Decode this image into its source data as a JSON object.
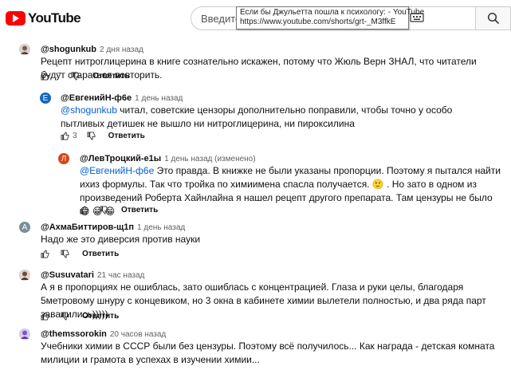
{
  "header": {
    "logo_text": "YouTube",
    "search_value": "Введите",
    "tooltip_title": "Если бы Джульетта пошла к психологу: - YouTube",
    "tooltip_url": "https://www.youtube.com/shorts/grt-_M3ffkE"
  },
  "colors": {
    "mention": "#065fd4",
    "brand_red": "#ff0000"
  },
  "comments": [
    {
      "author": "@shogunkub",
      "time": "2 дня назад",
      "text": "Рецепт нитроглицерина в книге сознательно искажен, потому что Жюль Верн ЗНАЛ, что читатели будут стараться повторить.",
      "likes": "17",
      "reply": "Ответить",
      "avatar_color": "#c9c9c9"
    },
    {
      "author": "@ЕвгенийН-ф6е",
      "time": "1 день назад",
      "avatar_letter": "Е",
      "avatar_color": "#1565c0",
      "mention": "@shogunkub",
      "text": " читал, советские цензоры дополнительно поправили, чтобы точно у особо пытливых детишек не вышло ни нитроглицерина, ни пироксилина",
      "likes": "3",
      "reply": "Ответить"
    },
    {
      "author": "@ЛевТроцкий-е1ы",
      "time": "1 день назад (изменено)",
      "avatar_letter": "Л",
      "avatar_color": "#d84315",
      "mention": "@ЕвгенийН-ф6е",
      "text": " Это правда. В книжке не были указаны пропорции. Поэтому я пытался найти ихиз формулы. Так что тройка по химиимена спасла получается. 🙂 . Но зато в одном из произведений Роберта Хайнлайна я нашел рецепт другого препарата. Там цензуры не было 😁 😁 😁",
      "reply": "Ответить"
    },
    {
      "author": "@АхмаБиттиров-щ1п",
      "time": "1 день назад",
      "avatar_letter": "А",
      "avatar_color": "#78909c",
      "text": "Надо же это диверсия против науки",
      "reply": "Ответить"
    },
    {
      "author": "@Susuvatari",
      "time": "21 час назад",
      "avatar_color": "#8d6e63",
      "text": "А я в пропорциях не ошиблась, зато ошиблась с концентрацией. Глаза и руки целы, благодаря 5метровому шнуру с концевиком, но 3 окна в кабинете химии вылетели полностью, и два ряда парт завалились)))))",
      "reply": "Ответить"
    },
    {
      "author": "@themssorokin",
      "time": "20 часов назад",
      "avatar_color": "#b39ddb",
      "text": "Учебники химии в СССР были без цензуры. Поэтому всё получилось... Как награда - детская комната милиции и грамота в успехах в изучении химии..."
    }
  ]
}
